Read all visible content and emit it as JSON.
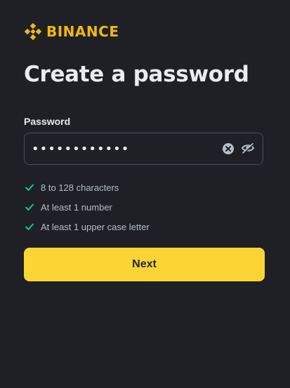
{
  "brand": {
    "name": "BINANCE",
    "logo_icon": "binance-logo-icon",
    "color": "#f0b90b"
  },
  "page": {
    "title": "Create a password"
  },
  "password_field": {
    "label": "Password",
    "value": "••••••••••••",
    "clear_icon": "clear-circle-icon",
    "visibility_icon": "eye-off-icon"
  },
  "requirements": [
    {
      "text": "8 to 128 characters",
      "icon": "check-icon",
      "met": true
    },
    {
      "text": "At least 1 number",
      "icon": "check-icon",
      "met": true
    },
    {
      "text": "At least 1 upper case letter",
      "icon": "check-icon",
      "met": true
    }
  ],
  "actions": {
    "next_label": "Next"
  },
  "colors": {
    "accent": "#fcd535",
    "success": "#0ecb81",
    "background": "#1e2026"
  }
}
